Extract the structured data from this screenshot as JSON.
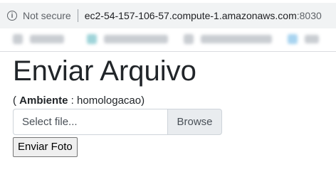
{
  "browser": {
    "security_label": "Not secure",
    "url_host": "ec2-54-157-106-57.compute-1.amazonaws.com",
    "url_port": ":8030"
  },
  "page": {
    "title": "Enviar Arquivo",
    "ambiente_open": "( ",
    "ambiente_label": "Ambiente",
    "ambiente_sep": " : ",
    "ambiente_value": "homologacao",
    "ambiente_close": ")",
    "file_placeholder": "Select file...",
    "browse_label": "Browse",
    "submit_label": "Enviar Foto"
  }
}
